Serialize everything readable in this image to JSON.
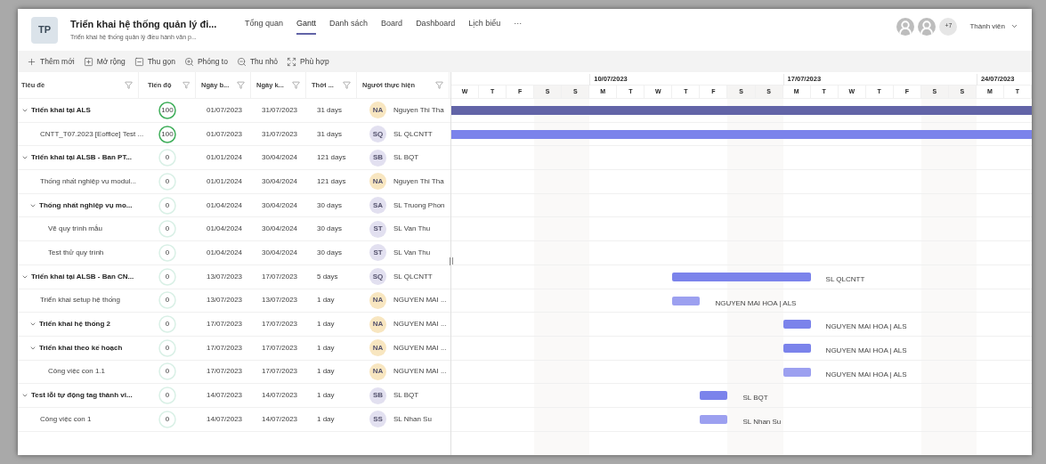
{
  "project": {
    "badge": "TP",
    "title": "Triển khai hệ thống quản lý đi...",
    "subtitle": "Triển khai hệ thống quản lý điều hành văn p..."
  },
  "tabs": [
    {
      "label": "Tổng quan",
      "selected": false
    },
    {
      "label": "Gantt",
      "selected": true
    },
    {
      "label": "Danh sách",
      "selected": false
    },
    {
      "label": "Board",
      "selected": false
    },
    {
      "label": "Dashboard",
      "selected": false
    },
    {
      "label": "Lịch biểu",
      "selected": false
    },
    {
      "label": "···",
      "selected": false
    }
  ],
  "members": {
    "more_count": "+7",
    "label": "Thành viên"
  },
  "toolbar": [
    {
      "kind": "add",
      "label": "Thêm mới"
    },
    {
      "kind": "expand",
      "label": "Mở rộng"
    },
    {
      "kind": "collapse",
      "label": "Thu gọn"
    },
    {
      "kind": "zoom_in",
      "label": "Phóng to"
    },
    {
      "kind": "zoom_out",
      "label": "Thu nhỏ"
    },
    {
      "kind": "fit",
      "label": "Phù hợp"
    }
  ],
  "table": {
    "columns": [
      "Tiêu đề",
      "Tiến độ",
      "Ngày b...",
      "Ngày k...",
      "Thời ...",
      "Người thực hiện"
    ],
    "rows": [
      {
        "kind": "group",
        "title": "Triển khai tại ALS",
        "expanded": true,
        "progress": {
          "text": "100",
          "complete": true
        },
        "start": "01/07/2023",
        "end": "31/07/2023",
        "duration": "31 days",
        "assignee": {
          "initials": "NA",
          "name": "Nguyen Thi Tha",
          "color": "#f8e6c0"
        },
        "color": "#6264a7",
        "children": [
          {
            "kind": "task",
            "title": "CNTT_T07.2023 [Eoffice] Test ...",
            "progress": {
              "text": "100",
              "complete": true
            },
            "start": "01/07/2023",
            "end": "31/07/2023",
            "duration": "31 days",
            "assignee": {
              "initials": "SQ",
              "name": "SL QLCNTT",
              "color": "#e2e0f0"
            },
            "color": "#7b83eb"
          }
        ]
      },
      {
        "kind": "group",
        "title": "Triển khai tại ALSB - Ban PT...",
        "expanded": true,
        "progress": {
          "text": "0",
          "complete": false
        },
        "start": "01/01/2024",
        "end": "30/04/2024",
        "duration": "121 days",
        "assignee": {
          "initials": "SB",
          "name": "SL BQT",
          "color": "#e2e0f0"
        },
        "children": [
          {
            "kind": "task",
            "title": "Thống nhất nghiệp vụ modul...",
            "progress": {
              "text": "0",
              "complete": false
            },
            "start": "01/01/2024",
            "end": "30/04/2024",
            "duration": "121 days",
            "assignee": {
              "initials": "NA",
              "name": "Nguyen Thi Tha",
              "color": "#f8e6c0"
            }
          },
          {
            "kind": "group",
            "title": "Thống nhất nghiệp vụ mo...",
            "expanded": true,
            "progress": {
              "text": "0",
              "complete": false
            },
            "start": "01/04/2024",
            "end": "30/04/2024",
            "duration": "30 days",
            "assignee": {
              "initials": "SA",
              "name": "SL Truong Phon",
              "color": "#e2e0f0"
            },
            "children": [
              {
                "kind": "task",
                "title": "Vẽ quy trình mẫu",
                "progress": {
                  "text": "0",
                  "complete": false
                },
                "start": "01/04/2024",
                "end": "30/04/2024",
                "duration": "30 days",
                "assignee": {
                  "initials": "ST",
                  "name": "SL Van Thu",
                  "color": "#e2e0f0"
                }
              },
              {
                "kind": "task",
                "title": "Test thử quy trình",
                "progress": {
                  "text": "0",
                  "complete": false
                },
                "start": "01/04/2024",
                "end": "30/04/2024",
                "duration": "30 days",
                "assignee": {
                  "initials": "ST",
                  "name": "SL Van Thu",
                  "color": "#e2e0f0"
                }
              }
            ]
          }
        ]
      },
      {
        "kind": "group",
        "title": "Triển khai tại ALSB - Ban CN...",
        "expanded": true,
        "progress": {
          "text": "0",
          "complete": false
        },
        "start": "13/07/2023",
        "end": "17/07/2023",
        "duration": "5 days",
        "assignee": {
          "initials": "SQ",
          "name": "SL QLCNTT",
          "color": "#e2e0f0"
        },
        "color": "#7b83eb",
        "bar_label": "SL QLCNTT",
        "children": [
          {
            "kind": "task",
            "title": "Triển khai setup hệ thống",
            "progress": {
              "text": "0",
              "complete": false
            },
            "start": "13/07/2023",
            "end": "13/07/2023",
            "duration": "1 day",
            "assignee": {
              "initials": "NA",
              "name": "NGUYEN MAI ...",
              "color": "#f8e6c0"
            },
            "color": "#9ca0f0",
            "bar_label": "NGUYEN MAI HOA | ALS"
          },
          {
            "kind": "group",
            "title": "Triển khai hệ thống 2",
            "expanded": true,
            "progress": {
              "text": "0",
              "complete": false
            },
            "start": "17/07/2023",
            "end": "17/07/2023",
            "duration": "1 day",
            "assignee": {
              "initials": "NA",
              "name": "NGUYEN MAI ...",
              "color": "#f8e6c0"
            },
            "color": "#7b83eb",
            "bar_label": "NGUYEN MAI HOA | ALS"
          },
          {
            "kind": "group",
            "title": "Triển khai theo kế hoạch",
            "expanded": true,
            "progress": {
              "text": "0",
              "complete": false
            },
            "start": "17/07/2023",
            "end": "17/07/2023",
            "duration": "1 day",
            "assignee": {
              "initials": "NA",
              "name": "NGUYEN MAI ...",
              "color": "#f8e6c0"
            },
            "color": "#7b83eb",
            "bar_label": "NGUYEN MAI HOA | ALS",
            "children": [
              {
                "kind": "task",
                "title": "Công việc con 1.1",
                "progress": {
                  "text": "0",
                  "complete": false
                },
                "start": "17/07/2023",
                "end": "17/07/2023",
                "duration": "1 day",
                "assignee": {
                  "initials": "NA",
                  "name": "NGUYEN MAI ...",
                  "color": "#f8e6c0"
                },
                "color": "#9ca0f0",
                "bar_label": "NGUYEN MAI HOA | ALS"
              }
            ]
          }
        ]
      },
      {
        "kind": "group",
        "title": "Test lỗi tự động tag thành vi...",
        "expanded": true,
        "progress": {
          "text": "0",
          "complete": false
        },
        "start": "14/07/2023",
        "end": "14/07/2023",
        "duration": "1 day",
        "assignee": {
          "initials": "SB",
          "name": "SL BQT",
          "color": "#e2e0f0"
        },
        "color": "#7b83eb",
        "bar_label": "SL BQT",
        "children": [
          {
            "kind": "task",
            "title": "Công việc con 1",
            "progress": {
              "text": "0",
              "complete": false
            },
            "start": "14/07/2023",
            "end": "14/07/2023",
            "duration": "1 day",
            "assignee": {
              "initials": "SS",
              "name": "SL Nhan Su",
              "color": "#e2e0f0"
            },
            "color": "#9ca0f0",
            "bar_label": "SL Nhan Su"
          }
        ]
      }
    ]
  },
  "timeline": {
    "days": [
      {
        "label": "W",
        "weekend": false
      },
      {
        "label": "T",
        "weekend": false
      },
      {
        "label": "F",
        "weekend": false
      },
      {
        "label": "S",
        "weekend": true
      },
      {
        "label": "S",
        "weekend": true
      },
      {
        "label": "M",
        "weekend": false,
        "week_label": "10/07/2023"
      },
      {
        "label": "T",
        "weekend": false
      },
      {
        "label": "W",
        "weekend": false
      },
      {
        "label": "T",
        "weekend": false
      },
      {
        "label": "F",
        "weekend": false
      },
      {
        "label": "S",
        "weekend": true
      },
      {
        "label": "S",
        "weekend": true
      },
      {
        "label": "M",
        "weekend": false,
        "week_label": "17/07/2023"
      },
      {
        "label": "T",
        "weekend": false
      },
      {
        "label": "W",
        "weekend": false
      },
      {
        "label": "T",
        "weekend": false
      },
      {
        "label": "F",
        "weekend": false
      },
      {
        "label": "S",
        "weekend": true
      },
      {
        "label": "S",
        "weekend": true
      },
      {
        "label": "M",
        "weekend": false,
        "week_label": "24/07/2023"
      },
      {
        "label": "T",
        "weekend": false
      }
    ]
  }
}
